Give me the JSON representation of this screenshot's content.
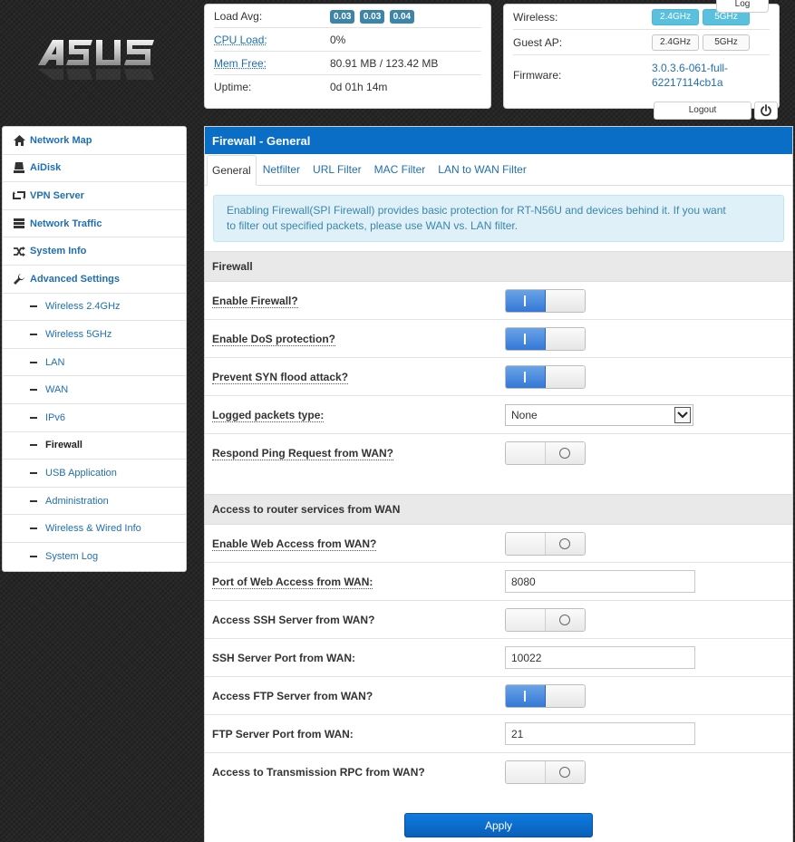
{
  "status": {
    "load_avg_label": "Load Avg:",
    "load_avg": [
      "0.03",
      "0.03",
      "0.04"
    ],
    "cpu_label": "CPU Load:",
    "cpu_value": "0%",
    "mem_label": "Mem Free:",
    "mem_value": "80.91 MB / 123.42 MB",
    "uptime_label": "Uptime:",
    "uptime_value": "0d 01h 14m"
  },
  "radio": {
    "wireless_label": "Wireless:",
    "guest_label": "Guest AP:",
    "firmware_label": "Firmware:",
    "band_24": "2.4GHz",
    "band_5": "5GHz",
    "firmware_line1": "3.0.3.6-061-full-",
    "firmware_line2": "62217114cb1a",
    "log_label": "Log",
    "logout_label": "Logout"
  },
  "sidebar": {
    "items": [
      {
        "label": "Network Map"
      },
      {
        "label": "AiDisk"
      },
      {
        "label": "VPN Server"
      },
      {
        "label": "Network Traffic"
      },
      {
        "label": "System Info"
      },
      {
        "label": "Advanced Settings"
      }
    ],
    "sub": [
      {
        "label": "Wireless 2.4GHz"
      },
      {
        "label": "Wireless 5GHz"
      },
      {
        "label": "LAN"
      },
      {
        "label": "WAN"
      },
      {
        "label": "IPv6"
      },
      {
        "label": "Firewall"
      },
      {
        "label": "USB Application"
      },
      {
        "label": "Administration"
      },
      {
        "label": "Wireless & Wired Info"
      },
      {
        "label": "System Log"
      }
    ]
  },
  "main": {
    "title": "Firewall - General",
    "tabs": [
      "General",
      "Netfilter",
      "URL Filter",
      "MAC Filter",
      "LAN to WAN Filter"
    ],
    "info": "Enabling Firewall(SPI Firewall) provides basic protection for RT-N56U and devices behind it. If you want to filter out packets, please use WAN vs. LAN filter.",
    "info_line1": "Enabling Firewall(SPI Firewall) provides basic protection for RT-N56U and devices behind it. If you want",
    "info_line2": "to filter out specified packets, please use WAN vs. LAN filter.",
    "section_firewall": "Firewall",
    "section_access": "Access to router services from WAN",
    "fields": {
      "enable_firewall": "Enable Firewall?",
      "enable_dos": "Enable DoS protection?",
      "prevent_syn": "Prevent SYN flood attack?",
      "logged_packets": "Logged packets type:",
      "logged_packets_value": "None",
      "respond_ping": "Respond Ping Request from WAN?",
      "web_access": "Enable Web Access from WAN?",
      "web_port": "Port of Web Access from WAN:",
      "web_port_value": "8080",
      "ssh_access": "Access SSH Server from WAN?",
      "ssh_port": "SSH Server Port from WAN:",
      "ssh_port_value": "10022",
      "ftp_access": "Access FTP Server from WAN?",
      "ftp_port": "FTP Server Port from WAN:",
      "ftp_port_value": "21",
      "rpc_access": "Access to Transmission RPC from WAN?"
    },
    "apply_label": "Apply"
  },
  "colors": {
    "accent": "#0b6ec6",
    "link": "#1f6fb2",
    "badge": "#3c84a8",
    "band_on": "#5bc0de"
  }
}
